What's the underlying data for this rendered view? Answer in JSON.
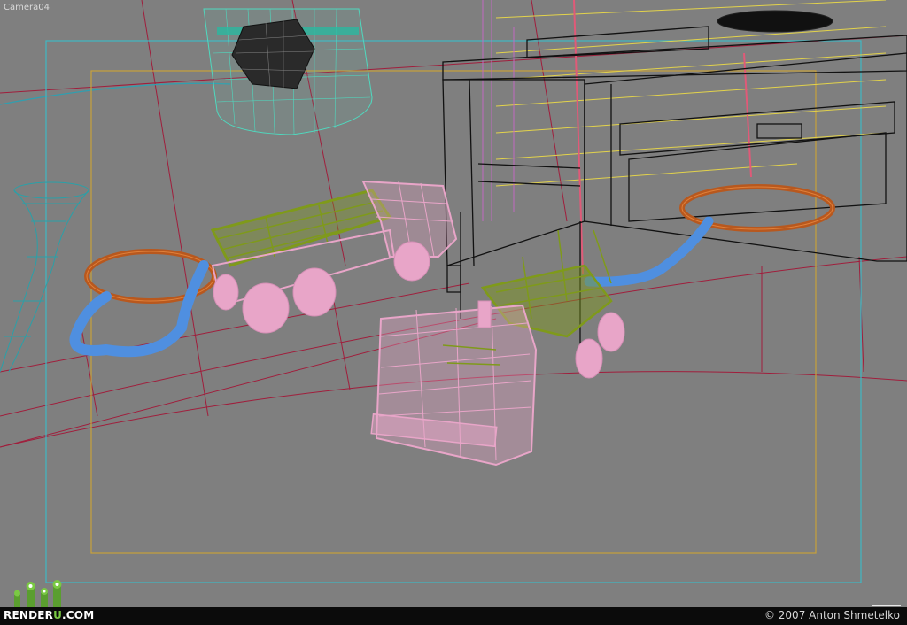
{
  "viewport": {
    "label": "Camera04",
    "background": "#7f7f7f"
  },
  "colors": {
    "safe_frame_outer": "#3fb8c4",
    "safe_frame_inner": "#c8a13a",
    "wall_edge": "#a01e3c",
    "floor_curve": "#9a2540",
    "hose": "#4f8fe0",
    "ring": "#b8581e",
    "truck_body": "#e8a5c8",
    "truck_tank": "#7f9a1a",
    "cabinet": "#111111",
    "lamp": "#4fd9bf",
    "vase": "#2aa0a8",
    "blinds": "#e3d34b",
    "blinds_accent": "#c26ac0"
  },
  "objects": [
    {
      "name": "lamp-shade",
      "icon": "wireframe-cylinder"
    },
    {
      "name": "lamp-bulb",
      "icon": "wireframe-sphere"
    },
    {
      "name": "vase",
      "icon": "wireframe-vase"
    },
    {
      "name": "cabinet",
      "icon": "wireframe-box"
    },
    {
      "name": "window-blinds",
      "icon": "wireframe-blinds"
    },
    {
      "name": "truck-rear",
      "icon": "wireframe-truck"
    },
    {
      "name": "truck-front",
      "icon": "wireframe-truck"
    },
    {
      "name": "hose-ring-left",
      "icon": "wireframe-torus"
    },
    {
      "name": "hose-ring-right",
      "icon": "wireframe-torus"
    }
  ],
  "footer": {
    "logo_part1": "RENDER",
    "logo_part2": "U",
    "logo_part3": ".COM",
    "copyright": "© 2007 Anton Shmetelko"
  }
}
